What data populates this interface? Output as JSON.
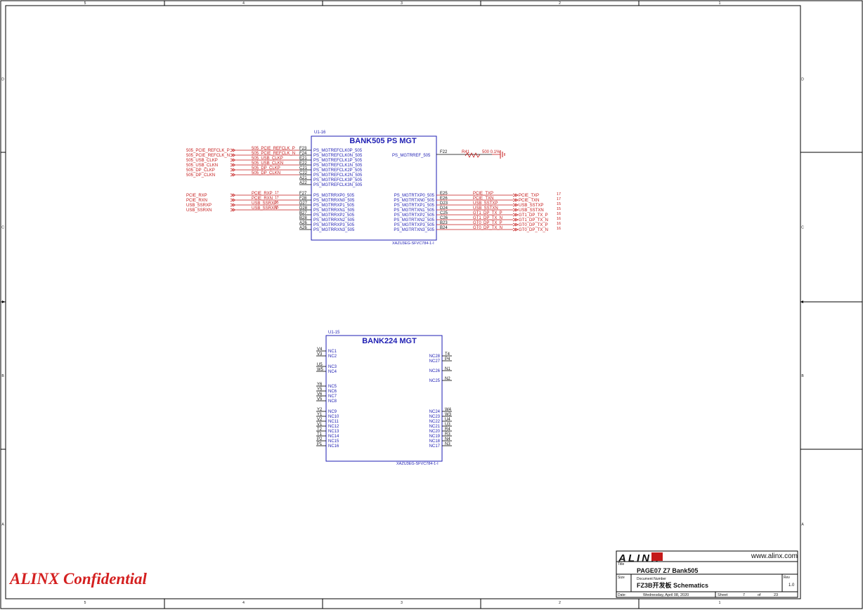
{
  "frame": {
    "top_cols": [
      "5",
      "4",
      "3",
      "2",
      "1"
    ],
    "bottom_cols": [
      "5",
      "4",
      "3",
      "2",
      "1"
    ],
    "rows": [
      "D",
      "C",
      "B",
      "A"
    ]
  },
  "bank505": {
    "ref": "U1-16",
    "title": "BANK505  PS  MGT",
    "part": "XAZU3EG-SFVC784-1-I",
    "left_pins": [
      {
        "pin": "F23",
        "name": "PS_MGTREFCLK0P_505"
      },
      {
        "pin": "F24",
        "name": "PS_MGTREFCLK0N_505"
      },
      {
        "pin": "E21",
        "name": "PS_MGTREFCLK1P_505"
      },
      {
        "pin": "E22",
        "name": "PS_MGTREFCLK1N_505"
      },
      {
        "pin": "C21",
        "name": "PS_MGTREFCLK2P_505"
      },
      {
        "pin": "C22",
        "name": "PS_MGTREFCLK2N_505"
      },
      {
        "pin": "A21",
        "name": "PS_MGTREFCLK3P_505"
      },
      {
        "pin": "A22",
        "name": "PS_MGTREFCLK3N_505"
      },
      {
        "pin": "F27",
        "name": "PS_MGTRRXP0_505"
      },
      {
        "pin": "F28",
        "name": "PS_MGTRRXN0_505"
      },
      {
        "pin": "D27",
        "name": "PS_MGTRRXP1_505"
      },
      {
        "pin": "D28",
        "name": "PS_MGTRRXN1_505"
      },
      {
        "pin": "B27",
        "name": "PS_MGTRRXP2_505"
      },
      {
        "pin": "B28",
        "name": "PS_MGTRRXN2_505"
      },
      {
        "pin": "A26",
        "name": "PS_MGTRRXP3_505"
      },
      {
        "pin": "A26",
        "name": "PS_MGTRRXN3_505"
      }
    ],
    "right_top": {
      "pin": "F22",
      "name": "PS_MGTRREF_505",
      "res_ref": "R41",
      "res_val": "500 0.1%"
    },
    "right_pins": [
      {
        "pin": "E25",
        "name": "PS_MGTRTXP0_505",
        "net": "PCIE_TXP",
        "port": "PCIE_TXP",
        "page": "17"
      },
      {
        "pin": "E26",
        "name": "PS_MGTRTXN0_505",
        "net": "PCIE_TXN",
        "port": "PCIE_TXN",
        "page": "17"
      },
      {
        "pin": "D23",
        "name": "PS_MGTRTXP1_505",
        "net": "USB_SSTXP",
        "port": "USB_SSTXP",
        "page": "15"
      },
      {
        "pin": "D24",
        "name": "PS_MGTRTXN1_505",
        "net": "USB_SSTXN",
        "port": "USB_SSTXN",
        "page": "15"
      },
      {
        "pin": "C25",
        "name": "PS_MGTRTXP2_505",
        "net": "GT1_DP_TX_P",
        "port": "GT1_DP_TX_P",
        "page": "16"
      },
      {
        "pin": "C26",
        "name": "PS_MGTRTXN2_505",
        "net": "GT1_DP_TX_N",
        "port": "GT1_DP_TX_N",
        "page": "16"
      },
      {
        "pin": "B23",
        "name": "PS_MGTRTXP3_505",
        "net": "GT0_DP_TX_P",
        "port": "GT0_DP_TX_P",
        "page": "16"
      },
      {
        "pin": "B24",
        "name": "PS_MGTRTXN3_505",
        "net": "GT0_DP_TX_N",
        "port": "GT0_DP_TX_N",
        "page": "16"
      }
    ],
    "left_ports": [
      {
        "port": "505_PCIE_REFCLK_P",
        "net": "505_PCIE_REFCLK_P"
      },
      {
        "port": "505_PCIE_REFCLK_N",
        "net": "505_PCIE_REFCLK_N"
      },
      {
        "port": "505_USB_CLKP",
        "net": "505_USB_CLKP"
      },
      {
        "port": "505_USB_CLKN",
        "net": "505_USB_CLKN"
      },
      {
        "port": "505_DP_CLKP",
        "net": "505_DP_CLKP"
      },
      {
        "port": "505_DP_CLKN",
        "net": "505_DP_CLKN"
      },
      {
        "port": "PCIE_RXP",
        "net": "PCIE_RXP",
        "page": "17"
      },
      {
        "port": "PCIE_RXN",
        "net": "PCIE_RXN",
        "page": "17"
      },
      {
        "port": "USB_SSRXP",
        "net": "USB_SSRXP",
        "page": "15"
      },
      {
        "port": "USB_SSRXN",
        "net": "USB_SSRXN",
        "page": "15"
      }
    ]
  },
  "bank224": {
    "ref": "U1-15",
    "title": "BANK224  MGT",
    "part": "XAZU3EG-SFVC784-1-I",
    "left_pins": [
      {
        "pin": "V4",
        "name": "NC1"
      },
      {
        "pin": "V3",
        "name": "NC2"
      },
      {
        "pin": "U5",
        "name": "NC3"
      },
      {
        "pin": "W5",
        "name": "NC4"
      },
      {
        "pin": "Y6",
        "name": "NC5"
      },
      {
        "pin": "Y5",
        "name": "NC6"
      },
      {
        "pin": "V6",
        "name": "NC7"
      },
      {
        "pin": "V5",
        "name": "NC8"
      },
      {
        "pin": "Y2",
        "name": "NC9"
      },
      {
        "pin": "Y1",
        "name": "NC10"
      },
      {
        "pin": "V2",
        "name": "NC11"
      },
      {
        "pin": "V1",
        "name": "NC12"
      },
      {
        "pin": "T2",
        "name": "NC13"
      },
      {
        "pin": "T1",
        "name": "NC14"
      },
      {
        "pin": "P2",
        "name": "NC15"
      },
      {
        "pin": "P1",
        "name": "NC16"
      }
    ],
    "right_pins": [
      {
        "pin": "T4",
        "name": "NC28"
      },
      {
        "pin": "P4",
        "name": "NC27"
      },
      {
        "pin": "N1",
        "name": "NC26"
      },
      {
        "pin": "N2",
        "name": "NC25"
      },
      {
        "pin": "W4",
        "name": "NC24"
      },
      {
        "pin": "W3",
        "name": "NC23"
      },
      {
        "pin": "U4",
        "name": "NC22"
      },
      {
        "pin": "U3",
        "name": "NC21"
      },
      {
        "pin": "R4",
        "name": "NC20"
      },
      {
        "pin": "R3",
        "name": "NC19"
      },
      {
        "pin": "N4",
        "name": "NC18"
      },
      {
        "pin": "N3",
        "name": "NC17"
      }
    ]
  },
  "title_block": {
    "logo": "ALINX",
    "website": "www.alinx.com",
    "title_label": "Title",
    "title": "PAGE07 Z7 Bank505",
    "size_label": "Size",
    "docnum_label": "Document Number",
    "docnum": "FZ3B开发板 Schematics",
    "rev_label": "Rev",
    "rev": "1.0",
    "date_label": "Date:",
    "date": "Wednesday, April 08, 2020",
    "sheet_label": "Sheet",
    "sheet": "7",
    "of_label": "of",
    "total": "23"
  },
  "confidential": "ALINX Confidential"
}
